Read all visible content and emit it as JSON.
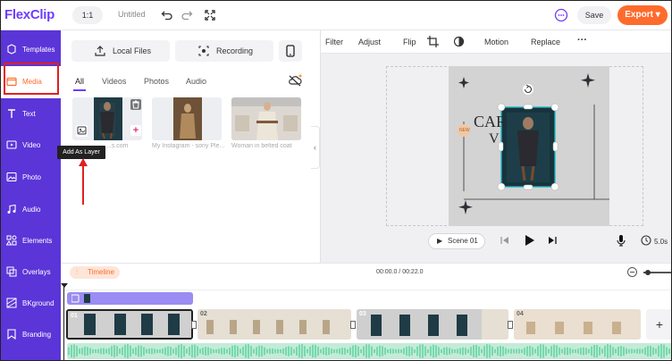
{
  "app": {
    "logo": "FlexClip"
  },
  "header": {
    "ratio": "1:1",
    "title": "Untitled",
    "save_label": "Save",
    "export_label": "Export",
    "accent": "#ff6b2c",
    "brand": "#6f3cff"
  },
  "sidebar": {
    "items": [
      {
        "label": "Templates",
        "icon": "templates-icon"
      },
      {
        "label": "Media",
        "icon": "media-icon"
      },
      {
        "label": "Text",
        "icon": "text-icon"
      },
      {
        "label": "Video",
        "icon": "video-icon"
      },
      {
        "label": "Photo",
        "icon": "photo-icon"
      },
      {
        "label": "Audio",
        "icon": "audio-icon"
      },
      {
        "label": "Elements",
        "icon": "elements-icon"
      },
      {
        "label": "Overlays",
        "icon": "overlays-icon"
      },
      {
        "label": "BKground",
        "icon": "background-icon"
      },
      {
        "label": "Branding",
        "icon": "branding-icon"
      }
    ],
    "active": "Media"
  },
  "media": {
    "local_files": "Local Files",
    "recording": "Recording",
    "tabs": [
      "All",
      "Videos",
      "Photos",
      "Audio"
    ],
    "active_tab": "All",
    "items": [
      {
        "caption": "...s.com"
      },
      {
        "caption": "My Instagram - sony Ple..."
      },
      {
        "caption": "Woman in belted coat"
      }
    ],
    "tooltip": "Add As Layer"
  },
  "toolbar": {
    "filter": "Filter",
    "adjust": "Adjust",
    "flip": "Flip",
    "motion": "Motion",
    "replace": "Replace"
  },
  "player": {
    "scene": "Scene 01",
    "duration": "5.0s"
  },
  "stage_text": {
    "big": "CAR",
    "line2": "V",
    "badge": "NEW"
  },
  "timeline": {
    "label": "Timeline",
    "time": "00:00.0 / 00:22.0",
    "clips": [
      "01",
      "02",
      "03",
      "04"
    ]
  }
}
